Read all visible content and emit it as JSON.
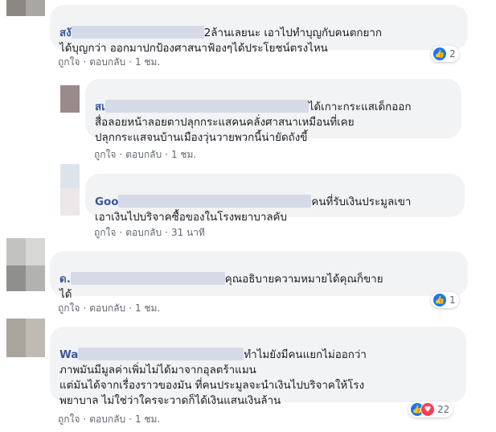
{
  "colors": {
    "author": "#385898",
    "bubble": "#f2f3f5",
    "meta": "#606770",
    "like": "#1877f2",
    "love": "#f33e58"
  },
  "comments": [
    {
      "author": "สงั",
      "text_line1_rest": "2ล้านเลยนะ เอาไปทำบุญกับคนตกยาก",
      "text_rest": "ได้บุญกว่า ออกมาปกป้องศาสนาฟ้องๆได้ประโยชน์ตรงไหน",
      "actions": {
        "like": "ถูกใจ",
        "reply": "ตอบกลับ",
        "time": "1 ชม."
      },
      "reactions": {
        "count": "2",
        "icons": [
          "like-icon"
        ]
      }
    },
    {
      "author": "สเ",
      "text_line1_rest": "ได้เกาะกระแสเด็กออก",
      "text_rest": "สื่อลอยหน้าลอยตาปลุกกระแสคนคลั่งศาสนาเหมือนที่เคย\nปลุกกระแสจนบ้านเมืองวุ่นวายพวกนี้น่ายัดถังขี้",
      "actions": {
        "like": "ถูกใจ",
        "reply": "ตอบกลับ",
        "time": "1 ชม."
      }
    },
    {
      "author": "Goo",
      "text_line1_rest": "คนที่รับเงินประมูลเขา",
      "text_rest": "เอาเงินไปบริจาคซื้อของในโรงพยาบาลคับ",
      "actions": {
        "like": "ถูกใจ",
        "reply": "ตอบกลับ",
        "time": "31 นาที"
      }
    },
    {
      "author": "ด.",
      "text_line1_rest": "คุณอธิบายความหมายได้คุณก็ขาย",
      "text_rest": "ได้",
      "actions": {
        "like": "ถูกใจ",
        "reply": "ตอบกลับ",
        "time": "1 ชม."
      },
      "reactions": {
        "count": "1",
        "icons": [
          "like-icon"
        ]
      }
    },
    {
      "author": "Wa",
      "text_line1_rest": "ทำไมยังมีคนแยกไม่ออกว่า",
      "text_rest": "ภาพมันมีมูลค่าเพิ่มไม่ได้มาจากอุลตร้าแมน\nแต่มันได้จากเรื่องราวของมัน ที่คนประมูลจะนำเงินไปบริจาคให้โรง\nพยาบาล ไม่ใช่ว่าใครจะวาดก็ได้เงินแสนเงินล้าน",
      "actions": {
        "like": "ถูกใจ",
        "reply": "ตอบกลับ",
        "time": "1 ชม."
      },
      "reactions": {
        "count": "22",
        "icons": [
          "like-icon",
          "love-icon"
        ]
      }
    }
  ]
}
